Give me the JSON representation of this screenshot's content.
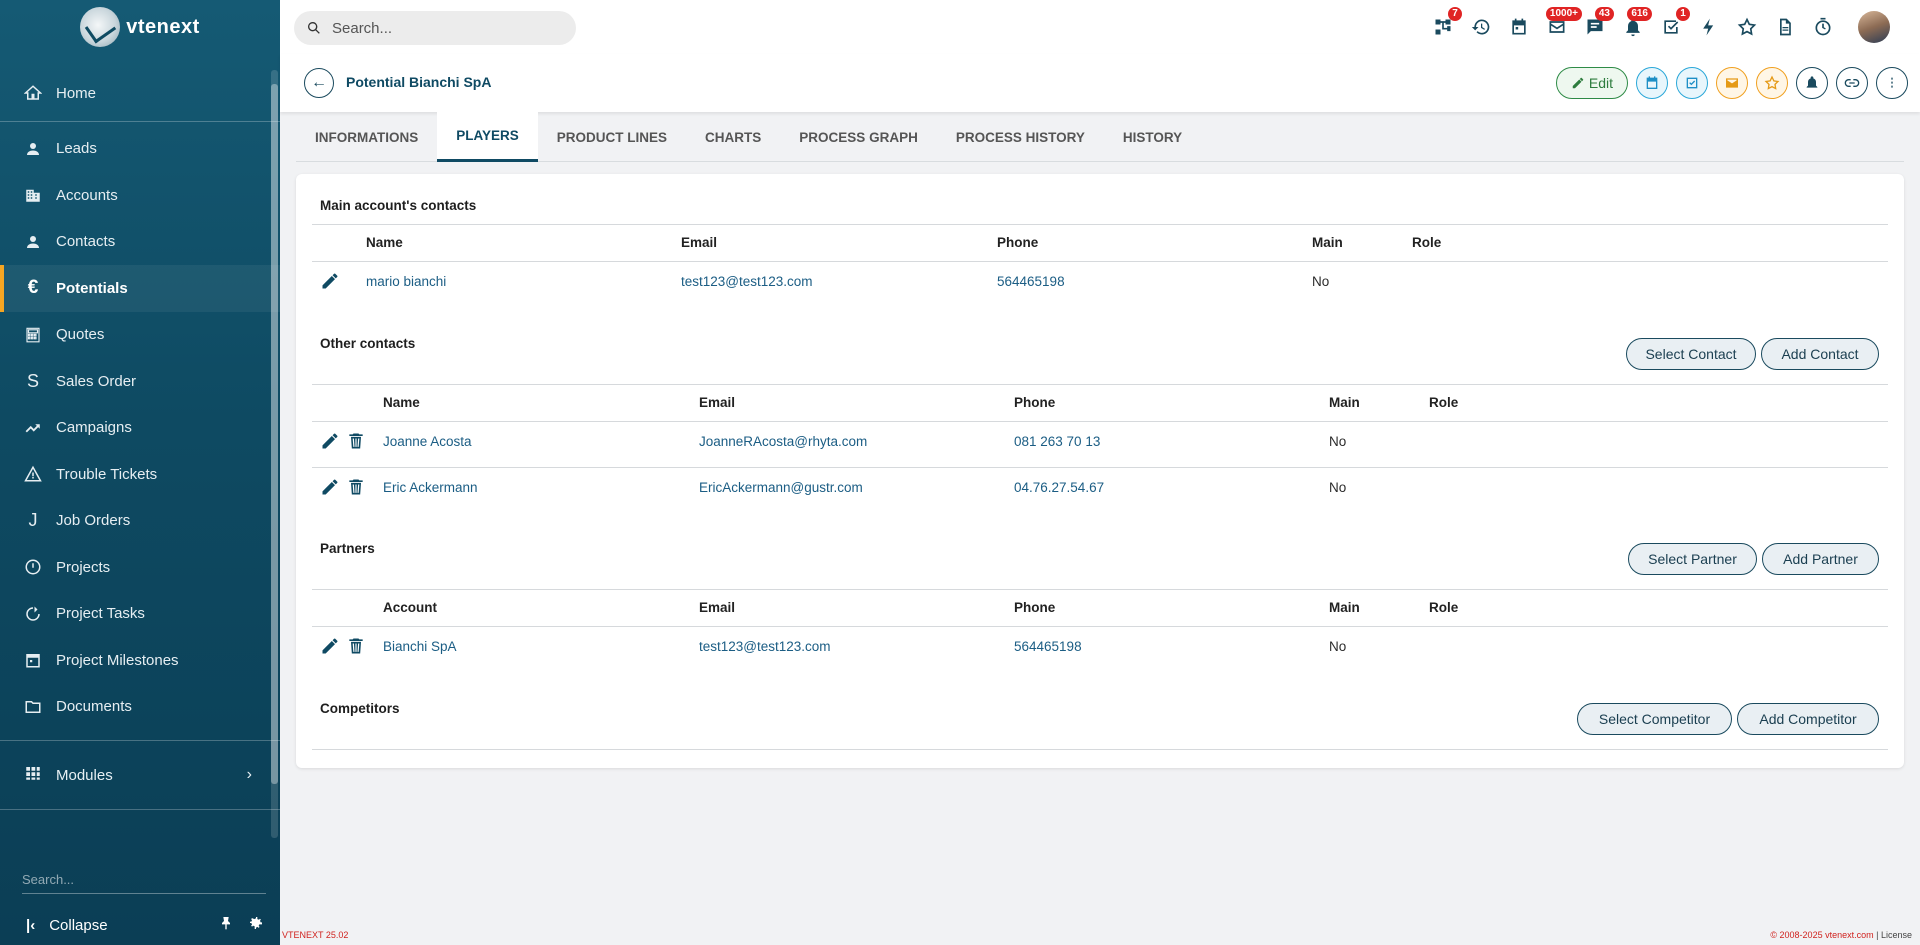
{
  "app": {
    "name": "vtenext",
    "version": "VTENEXT 25.02",
    "copyright": "© 2008-2025 vtenext.com",
    "license": "License"
  },
  "sidebar": {
    "items": [
      {
        "label": "Home",
        "icon": "home-icon"
      },
      {
        "label": "Leads",
        "icon": "person-icon"
      },
      {
        "label": "Accounts",
        "icon": "building-icon"
      },
      {
        "label": "Contacts",
        "icon": "person-icon"
      },
      {
        "label": "Potentials",
        "icon": "euro-icon"
      },
      {
        "label": "Quotes",
        "icon": "calculator-icon"
      },
      {
        "label": "Sales Order",
        "icon": "s-letter-icon"
      },
      {
        "label": "Campaigns",
        "icon": "trend-icon"
      },
      {
        "label": "Trouble Tickets",
        "icon": "warning-icon"
      },
      {
        "label": "Job Orders",
        "icon": "j-letter-icon"
      },
      {
        "label": "Projects",
        "icon": "clock-icon"
      },
      {
        "label": "Project Tasks",
        "icon": "refresh-icon"
      },
      {
        "label": "Project Milestones",
        "icon": "calendar-icon"
      },
      {
        "label": "Documents",
        "icon": "folder-icon"
      }
    ],
    "modules": "Modules",
    "search_placeholder": "Search...",
    "collapse": "Collapse"
  },
  "topbar": {
    "search_placeholder": "Search...",
    "badges": {
      "processes": "7",
      "mail": "1000+",
      "chat": "43",
      "notifications": "616",
      "tasks": "1"
    }
  },
  "record": {
    "title": "Potential Bianchi SpA",
    "edit_label": "Edit"
  },
  "tabs": [
    "INFORMATIONS",
    "PLAYERS",
    "PRODUCT LINES",
    "CHARTS",
    "PROCESS GRAPH",
    "PROCESS HISTORY",
    "HISTORY"
  ],
  "main_contacts": {
    "title": "Main account's contacts",
    "headers": [
      "Name",
      "Email",
      "Phone",
      "Main",
      "Role"
    ],
    "rows": [
      {
        "name": "mario bianchi",
        "email": "test123@test123.com",
        "phone": "564465198",
        "main": "No",
        "role": ""
      }
    ]
  },
  "other_contacts": {
    "title": "Other contacts",
    "select_label": "Select Contact",
    "add_label": "Add Contact",
    "headers": [
      "Name",
      "Email",
      "Phone",
      "Main",
      "Role"
    ],
    "rows": [
      {
        "name": "Joanne Acosta",
        "email": "JoanneRAcosta@rhyta.com",
        "phone": "081 263 70 13",
        "main": "No",
        "role": ""
      },
      {
        "name": "Eric Ackermann",
        "email": "EricAckermann@gustr.com",
        "phone": "04.76.27.54.67",
        "main": "No",
        "role": ""
      }
    ]
  },
  "partners": {
    "title": "Partners",
    "select_label": "Select Partner",
    "add_label": "Add Partner",
    "headers": [
      "Account",
      "Email",
      "Phone",
      "Main",
      "Role"
    ],
    "rows": [
      {
        "name": "Bianchi SpA",
        "email": "test123@test123.com",
        "phone": "564465198",
        "main": "No",
        "role": ""
      }
    ]
  },
  "competitors": {
    "title": "Competitors",
    "select_label": "Select Competitor",
    "add_label": "Add Competitor"
  }
}
